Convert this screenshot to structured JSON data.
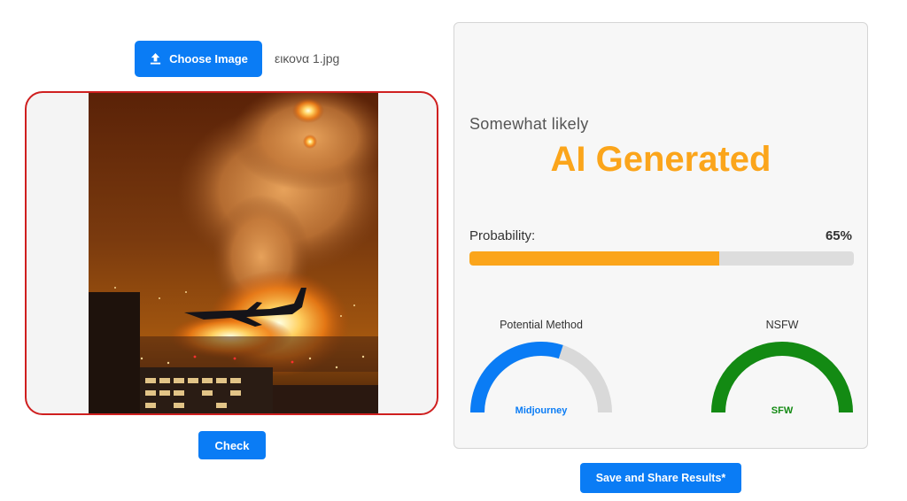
{
  "upload": {
    "choose_label": "Choose Image",
    "file_name": "εικονα 1.jpg"
  },
  "image_panel": {
    "border_color": "#cf1f1f",
    "check_label": "Check"
  },
  "result": {
    "likelihood": "Somewhat likely",
    "verdict": "AI Generated",
    "verdict_color": "#fba51b",
    "probability_label": "Probability:",
    "probability_text": "65%",
    "probability_value": 0.65,
    "gauges": [
      {
        "title": "Potential Method",
        "label": "Midjourney",
        "value": 0.6,
        "color": "#0a7cf5"
      },
      {
        "title": "NSFW",
        "label": "SFW",
        "value": 1.0,
        "color": "#138a13"
      }
    ]
  },
  "save_label": "Save and Share Results*",
  "icons": {
    "upload": "upload-icon"
  }
}
